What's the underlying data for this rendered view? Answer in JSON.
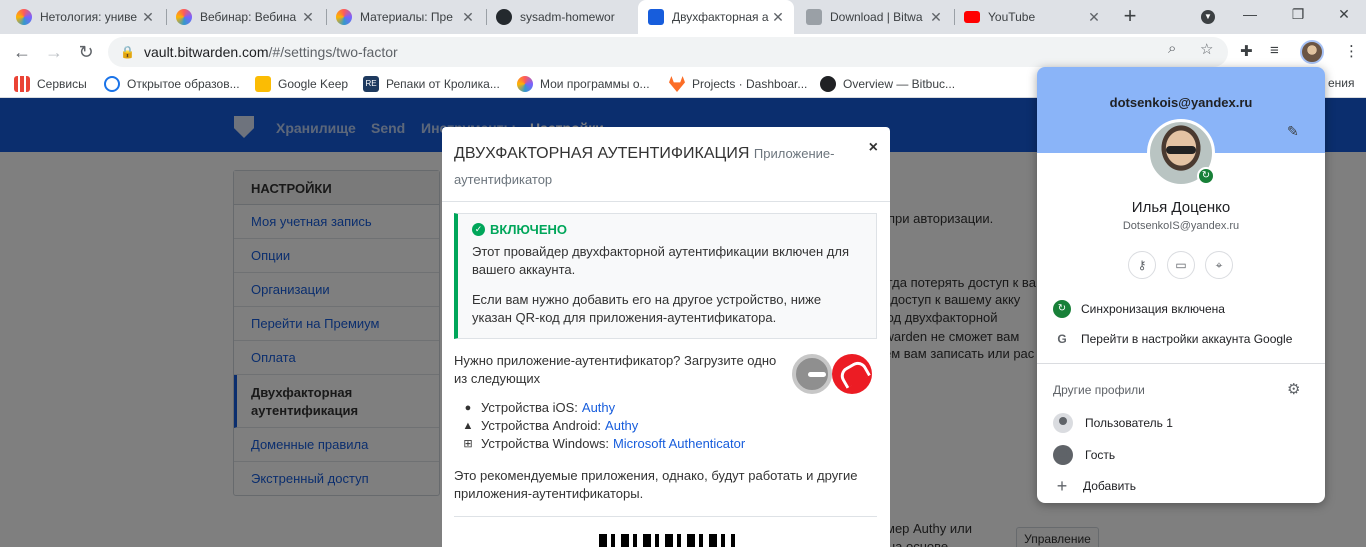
{
  "tabs": [
    {
      "title": "Нетология: униве",
      "favicon_color": "#7b61ff"
    },
    {
      "title": "Вебинар: Вебина",
      "favicon_color": "#7b61ff"
    },
    {
      "title": "Материалы: Пре",
      "favicon_color": "#7b61ff"
    },
    {
      "title": "sysadm-homewor",
      "favicon_color": "#24292e"
    },
    {
      "title": "Двухфакторная а",
      "favicon_color": "#175ddc"
    },
    {
      "title": "Download | Bitwa",
      "favicon_color": "#9aa0a6"
    },
    {
      "title": "YouTube",
      "favicon_color": "#ff0000"
    }
  ],
  "toolbar": {
    "url_host": "vault.bitwarden.com",
    "url_path": "/#/settings/two-factor"
  },
  "bookmarks": [
    {
      "label": "Сервисы",
      "color": "#4285f4"
    },
    {
      "label": "Открытое образов...",
      "color": "#1a73e8"
    },
    {
      "label": "Google Keep",
      "color": "#fbbc04"
    },
    {
      "label": "Репаки от Кролика...",
      "color": "#1e3a5f"
    },
    {
      "label": "Мои программы о...",
      "color": "#7b61ff"
    },
    {
      "label": "Projects · Dashboar...",
      "color": "#fc6d26"
    },
    {
      "label": "Overview — Bitbuc...",
      "color": "#202124"
    }
  ],
  "bitwarden": {
    "nav": [
      "Хранилище",
      "Send",
      "Инструменты",
      "Настройки"
    ],
    "settings_header": "НАСТРОЙКИ",
    "settings_items": [
      "Моя учетная запись",
      "Опции",
      "Организации",
      "Перейти на Премиум",
      "Оплата",
      "Двухфакторная аутентификация",
      "Доменные правила",
      "Экстренный доступ"
    ],
    "bg_lines": [
      "при авторизации.",
      "гда потерять доступ к ва",
      "ть доступ к вашему акку",
      "етод двухфакторной",
      "itwarden не сможет вам",
      "ем вам записать или рас",
      "мер Authy или",
      "на основе"
    ],
    "manage_button": "Управление"
  },
  "modal": {
    "title": "ДВУХФАКТОРНАЯ АУТЕНТИФИКАЦИЯ",
    "subtitle": "Приложение-аутентификатор",
    "close": "×",
    "callout_title": "ВКЛЮЧЕНО",
    "callout_p1": "Этот провайдер двухфакторной аутентификации включен для вашего аккаунта.",
    "callout_p2": "Если вам нужно добавить его на другое устройство, ниже указан QR-код для приложения-аутентификатора.",
    "need_app": "Нужно приложение-аутентификатор? Загрузите одно из следующих",
    "apps": [
      {
        "os_icon": "apple-icon",
        "label": "Устройства iOS:",
        "link": "Authy"
      },
      {
        "os_icon": "android-icon",
        "label": "Устройства Android:",
        "link": "Authy"
      },
      {
        "os_icon": "windows-icon",
        "label": "Устройства Windows:",
        "link": "Microsoft Authenticator"
      }
    ],
    "recommend": "Это рекомендуемые приложения, однако, будут работать и другие приложения-аутентификаторы."
  },
  "profile": {
    "email_top": "dotsenkois@yandex.ru",
    "name": "Илья Доценко",
    "email": "DotsenkoIS@yandex.ru",
    "sync": "Синхронизация включена",
    "google_settings": "Перейти в настройки аккаунта Google",
    "other_profiles": "Другие профили",
    "user1": "Пользователь 1",
    "guest": "Гость",
    "add": "Добавить",
    "sync_color": "#188038"
  },
  "cutoff_text": "ения"
}
